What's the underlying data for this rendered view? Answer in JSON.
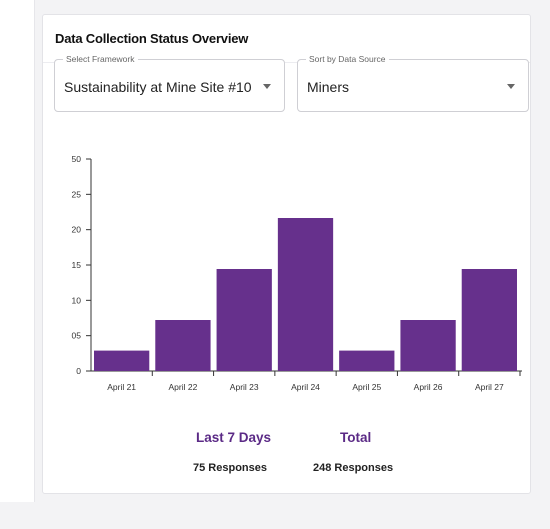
{
  "card": {
    "title": "Data Collection Status Overview"
  },
  "filters": {
    "framework": {
      "legend": "Select Framework",
      "value": "Sustainability at Mine Site #10"
    },
    "data_source": {
      "legend": "Sort by Data Source",
      "value": "Miners"
    }
  },
  "chart_data": {
    "type": "bar",
    "categories": [
      "April 21",
      "April 22",
      "April 23",
      "April 24",
      "April 25",
      "April 26",
      "April 27"
    ],
    "values": [
      3,
      7.5,
      15,
      22.5,
      3,
      7.5,
      15
    ],
    "yticks": [
      "0",
      "05",
      "10",
      "15",
      "20",
      "25",
      "50"
    ],
    "ylim": [
      0,
      30
    ],
    "bar_color": "#66308c",
    "title": "",
    "xlabel": "",
    "ylabel": ""
  },
  "summary": {
    "last7": {
      "label": "Last 7 Days",
      "value": "75 Responses"
    },
    "total": {
      "label": "Total",
      "value": "248 Responses"
    }
  },
  "colors": {
    "accent": "#5b2a86",
    "bar": "#66308c"
  }
}
